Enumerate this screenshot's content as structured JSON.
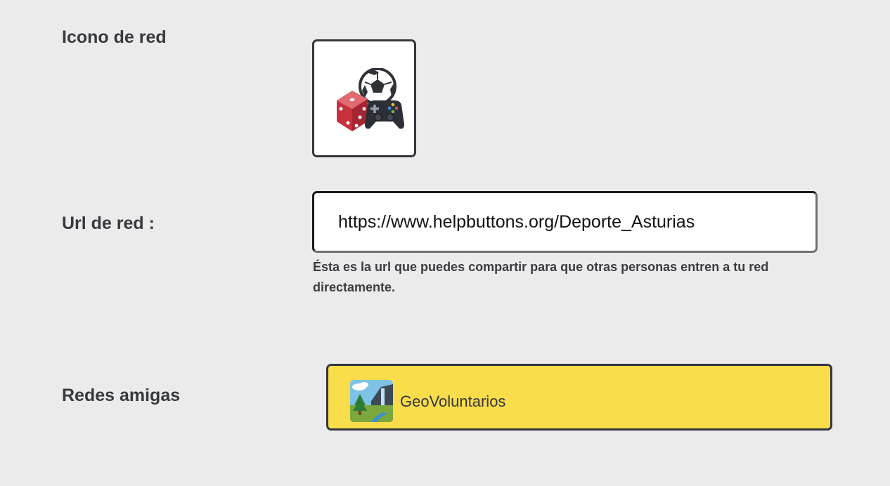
{
  "network_icon": {
    "label": "Icono de red",
    "icon": "dice-soccer-ball-gamepad-icon"
  },
  "network_url": {
    "label": "Url de red :",
    "value": "https://www.helpbuttons.org/Deporte_Asturias",
    "hint": "Ésta es la url que puedes compartir para que otras personas entren a tu red directamente."
  },
  "friend_networks": {
    "label": "Redes amigas",
    "items": [
      {
        "name": "GeoVoluntarios",
        "icon": "landscape-waterfall-icon"
      }
    ]
  },
  "colors": {
    "background": "#ebebeb",
    "card_accent": "#f9dd4b",
    "border": "#33363b"
  }
}
